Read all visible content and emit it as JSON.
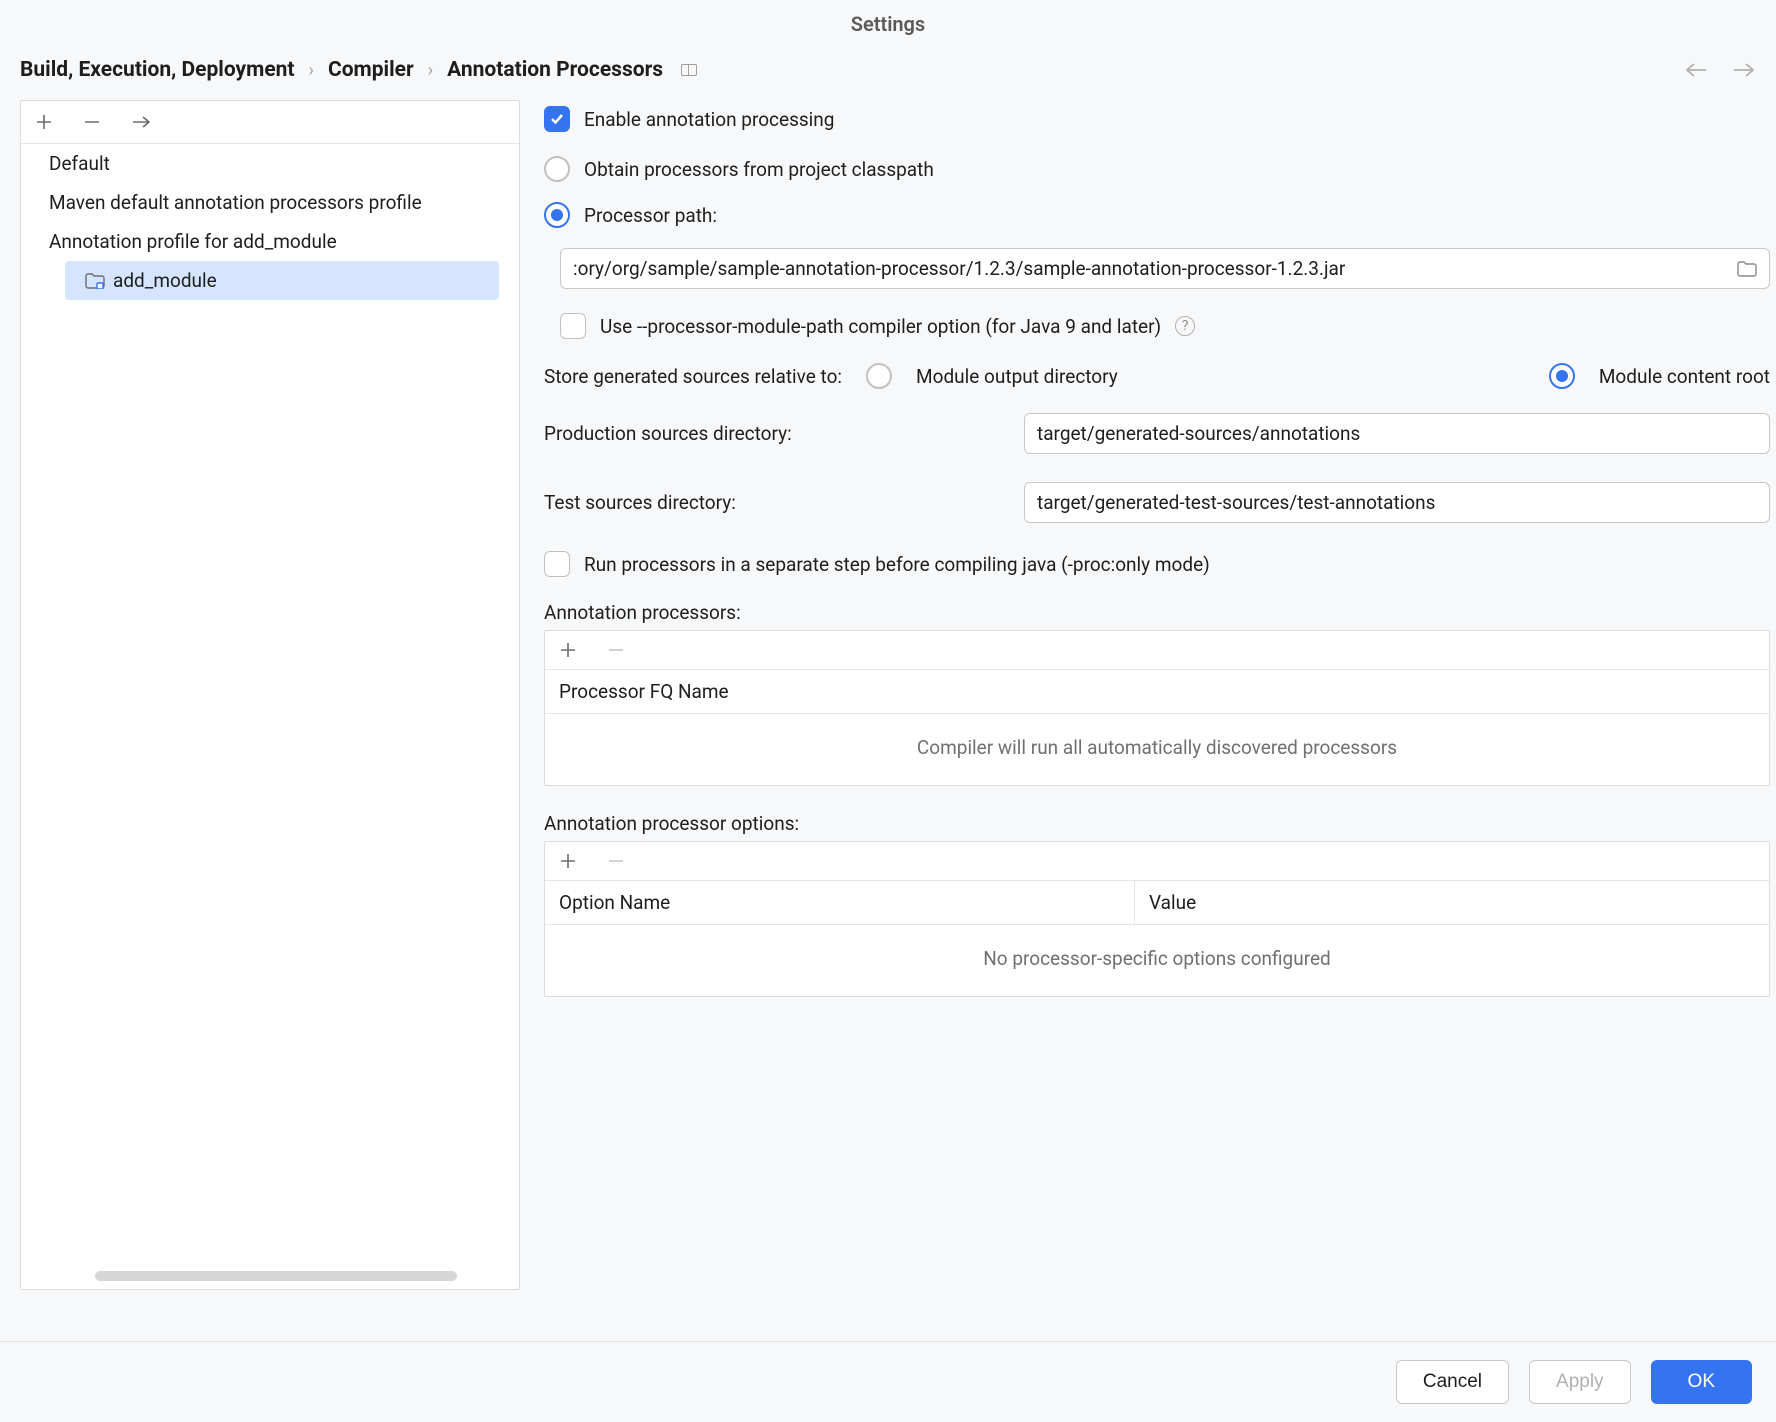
{
  "title": "Settings",
  "breadcrumbs": [
    "Build, Execution, Deployment",
    "Compiler",
    "Annotation Processors"
  ],
  "tree": {
    "items": [
      "Default",
      "Maven default annotation processors profile",
      "Annotation profile for add_module"
    ],
    "child": "add_module"
  },
  "settings": {
    "enable_label": "Enable annotation processing",
    "obtain_label": "Obtain processors from project classpath",
    "processor_path_label": "Processor path:",
    "processor_path_value": ":ory/org/sample/sample-annotation-processor/1.2.3/sample-annotation-processor-1.2.3.jar",
    "module_path_label": "Use --processor-module-path compiler option (for Java 9 and later)",
    "store_label": "Store generated sources relative to:",
    "store_opt1": "Module output directory",
    "store_opt2": "Module content root",
    "prod_dir_label": "Production sources directory:",
    "prod_dir_value": "target/generated-sources/annotations",
    "test_dir_label": "Test sources directory:",
    "test_dir_value": "target/generated-test-sources/test-annotations",
    "separate_step_label": "Run processors in a separate step before compiling java (-proc:only mode)",
    "ap_header": "Annotation processors:",
    "ap_col": "Processor FQ Name",
    "ap_empty": "Compiler will run all automatically discovered processors",
    "opt_header": "Annotation processor options:",
    "opt_col1": "Option Name",
    "opt_col2": "Value",
    "opt_empty": "No processor-specific options configured"
  },
  "buttons": {
    "cancel": "Cancel",
    "apply": "Apply",
    "ok": "OK"
  }
}
